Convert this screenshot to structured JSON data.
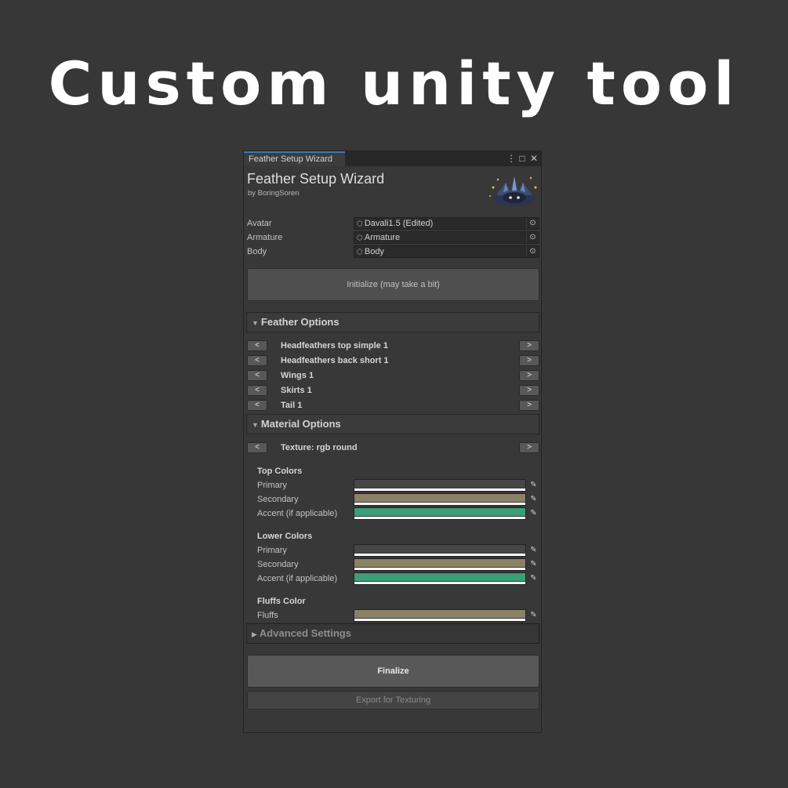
{
  "headline": "Custom unity tool",
  "window": {
    "tab_label": "Feather Setup Wizard",
    "title": "Feather Setup Wizard",
    "subtitle": "by BoringSoren",
    "controls": {
      "menu": "⋮",
      "maximize": "□",
      "close": "✕"
    }
  },
  "fields": [
    {
      "label": "Avatar",
      "value": "Davali1.5 (Edited)"
    },
    {
      "label": "Armature",
      "value": "Armature"
    },
    {
      "label": "Body",
      "value": "Body"
    }
  ],
  "initialize_label": "Initialize (may take a bit)",
  "feather_options": {
    "title": "Feather Options",
    "items": [
      "Headfeathers top simple 1",
      "Headfeathers back short 1",
      "Wings 1",
      "Skirts 1",
      "Tail 1"
    ]
  },
  "arrows": {
    "prev": "<",
    "next": ">"
  },
  "material_options": {
    "title": "Material Options",
    "texture": "Texture: rgb round"
  },
  "top_colors": {
    "title": "Top Colors",
    "rows": [
      {
        "label": "Primary",
        "color": "#464646"
      },
      {
        "label": "Secondary",
        "color": "#8b8167"
      },
      {
        "label": "Accent (if applicable)",
        "color": "#3a9e78"
      }
    ]
  },
  "lower_colors": {
    "title": "Lower Colors",
    "rows": [
      {
        "label": "Primary",
        "color": "#464646"
      },
      {
        "label": "Secondary",
        "color": "#8b8167"
      },
      {
        "label": "Accent (if applicable)",
        "color": "#3a9e78"
      }
    ]
  },
  "fluffs_color": {
    "title": "Fluffs Color",
    "rows": [
      {
        "label": "Fluffs",
        "color": "#8b8167"
      }
    ]
  },
  "advanced_settings": "Advanced Settings",
  "finalize_label": "Finalize",
  "export_label": "Export for Texturing",
  "icons": {
    "object_field": "cube-icon",
    "picker": "object-picker-icon",
    "eyedropper": "eyedropper-icon"
  }
}
